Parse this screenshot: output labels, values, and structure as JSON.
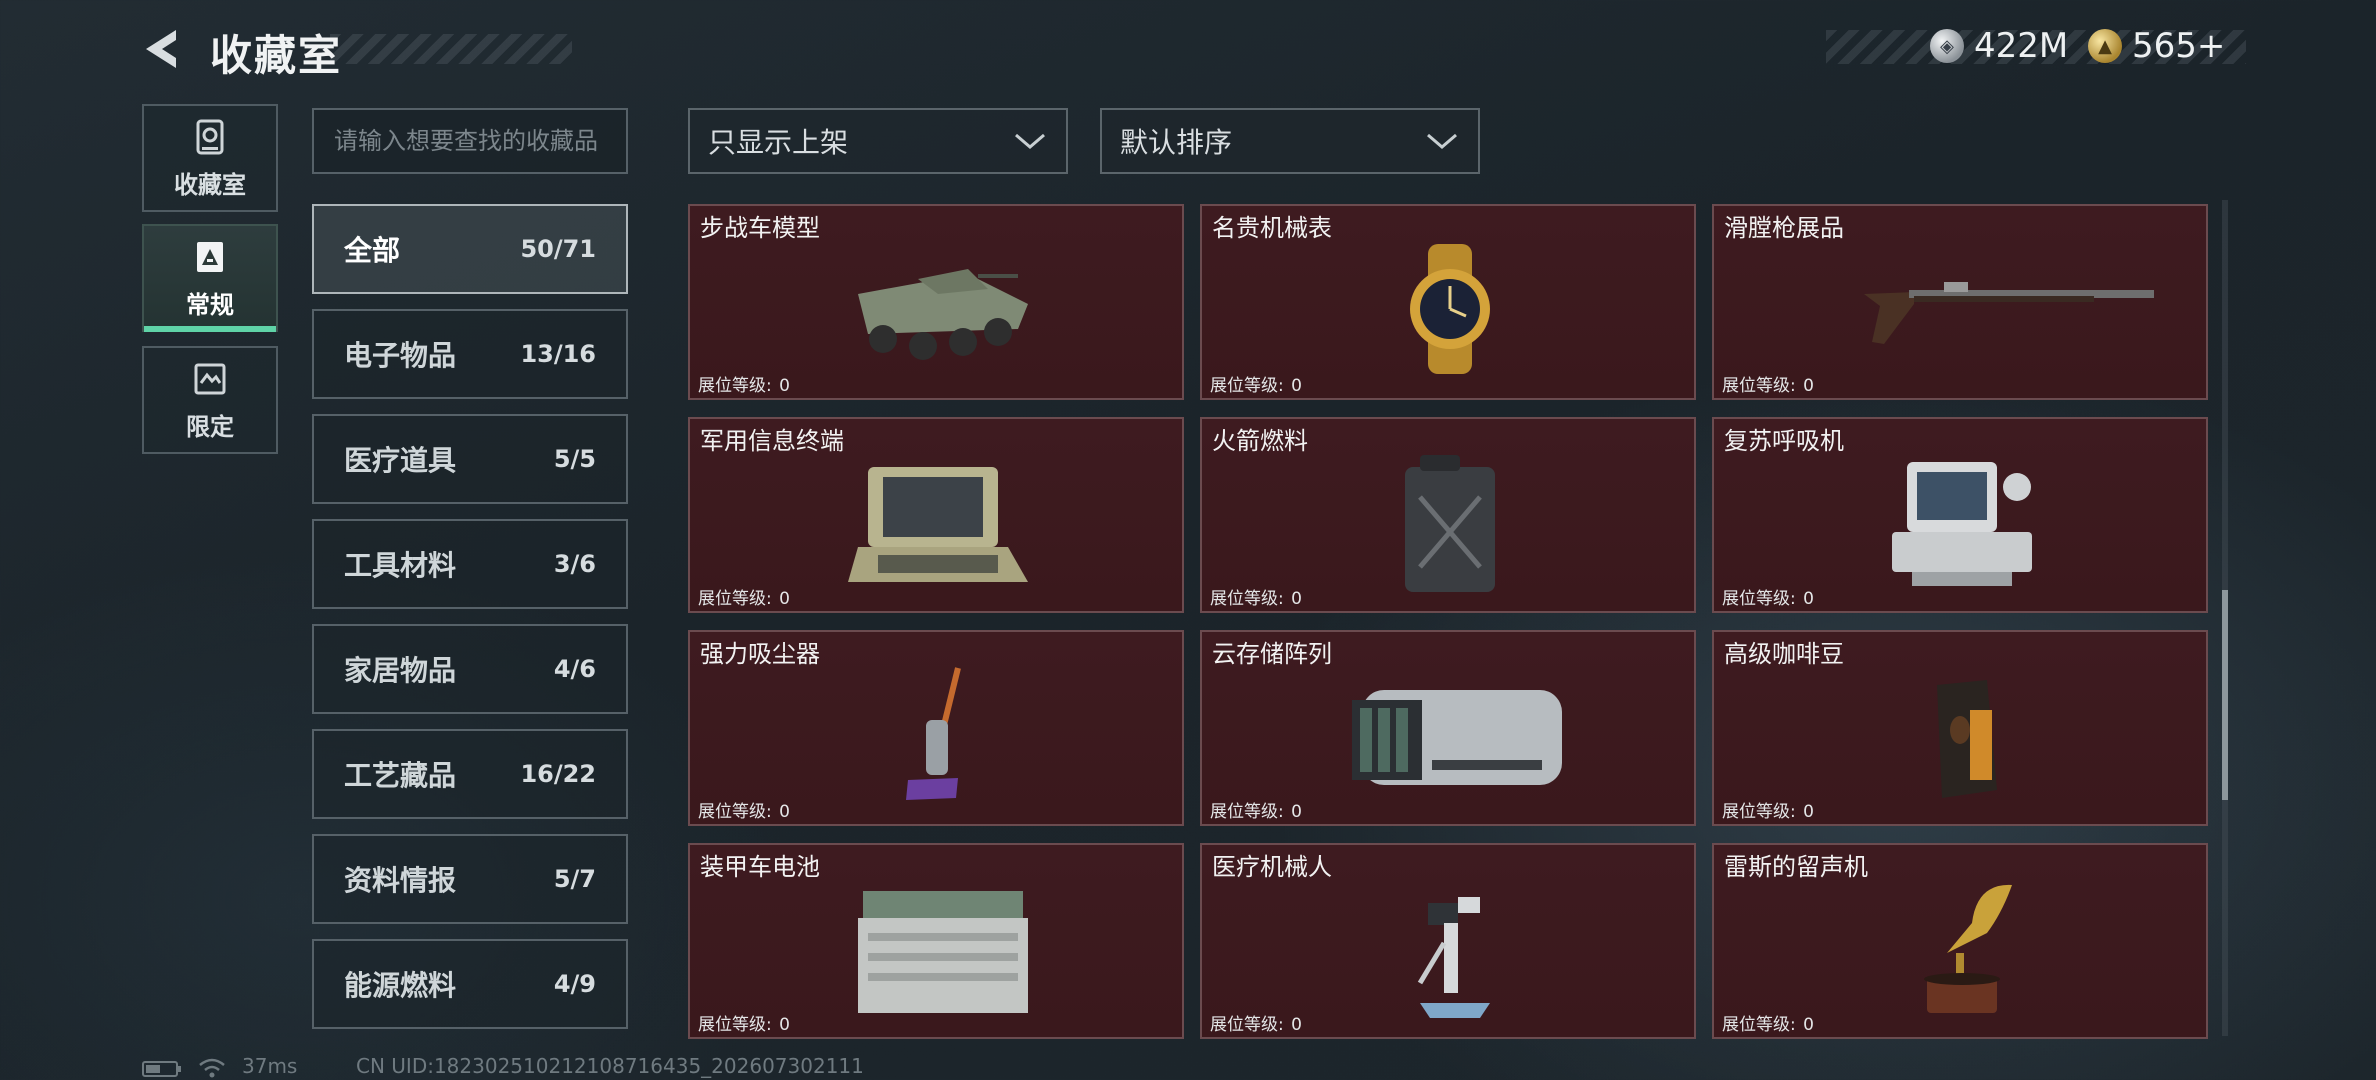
{
  "header": {
    "title": "收藏室",
    "currencies": [
      {
        "icon": "silver-coin-icon",
        "amount": "422M"
      },
      {
        "icon": "gold-coin-icon",
        "amount": "565+"
      }
    ]
  },
  "side_tabs": [
    {
      "label": "收藏室",
      "icon": "vault-icon",
      "active": false
    },
    {
      "label": "常规",
      "icon": "regular-collection-icon",
      "active": true
    },
    {
      "label": "限定",
      "icon": "limited-collection-icon",
      "active": false
    }
  ],
  "search": {
    "placeholder": "请输入想要查找的收藏品"
  },
  "categories": [
    {
      "name": "全部",
      "count": "50/71",
      "active": true
    },
    {
      "name": "电子物品",
      "count": "13/16",
      "active": false
    },
    {
      "name": "医疗道具",
      "count": "5/5",
      "active": false
    },
    {
      "name": "工具材料",
      "count": "3/6",
      "active": false
    },
    {
      "name": "家居物品",
      "count": "4/6",
      "active": false
    },
    {
      "name": "工艺藏品",
      "count": "16/22",
      "active": false
    },
    {
      "name": "资料情报",
      "count": "5/7",
      "active": false
    },
    {
      "name": "能源燃料",
      "count": "4/9",
      "active": false
    }
  ],
  "filters": {
    "listed_only": "只显示上架",
    "sort": "默认排序"
  },
  "level_label": "展位等级:",
  "items": [
    {
      "name": "步战车模型",
      "level": "0",
      "icon": "ifv-model-icon"
    },
    {
      "name": "名贵机械表",
      "level": "0",
      "icon": "luxury-watch-icon"
    },
    {
      "name": "滑膛枪展品",
      "level": "0",
      "icon": "musket-icon"
    },
    {
      "name": "军用信息终端",
      "level": "0",
      "icon": "military-terminal-icon"
    },
    {
      "name": "火箭燃料",
      "level": "0",
      "icon": "fuel-canister-icon"
    },
    {
      "name": "复苏呼吸机",
      "level": "0",
      "icon": "ventilator-icon"
    },
    {
      "name": "强力吸尘器",
      "level": "0",
      "icon": "vacuum-cleaner-icon"
    },
    {
      "name": "云存储阵列",
      "level": "0",
      "icon": "storage-array-icon"
    },
    {
      "name": "高级咖啡豆",
      "level": "0",
      "icon": "coffee-beans-icon"
    },
    {
      "name": "装甲车电池",
      "level": "0",
      "icon": "vehicle-battery-icon"
    },
    {
      "name": "医疗机械人",
      "level": "0",
      "icon": "medical-robot-icon"
    },
    {
      "name": "雷斯的留声机",
      "level": "0",
      "icon": "gramophone-icon"
    }
  ],
  "footer": {
    "ping": "37ms",
    "uid": "CN UID:18230251021210871643​5_202607302111"
  }
}
